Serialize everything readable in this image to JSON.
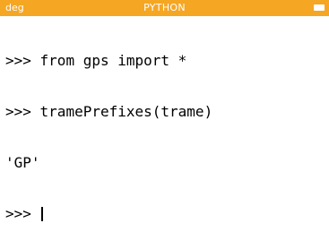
{
  "status_bar": {
    "angle_mode": "deg",
    "title": "PYTHON",
    "battery_icon": "battery-icon",
    "background_color": "#f5a623"
  },
  "console": {
    "prompt": ">>>",
    "lines": [
      {
        "type": "input",
        "prompt": ">>>",
        "text": " from gps import *"
      },
      {
        "type": "input",
        "prompt": ">>>",
        "text": " tramePrefixes(trame)"
      },
      {
        "type": "output",
        "text": "'GP'"
      },
      {
        "type": "input",
        "prompt": ">>>",
        "text": " "
      }
    ]
  }
}
